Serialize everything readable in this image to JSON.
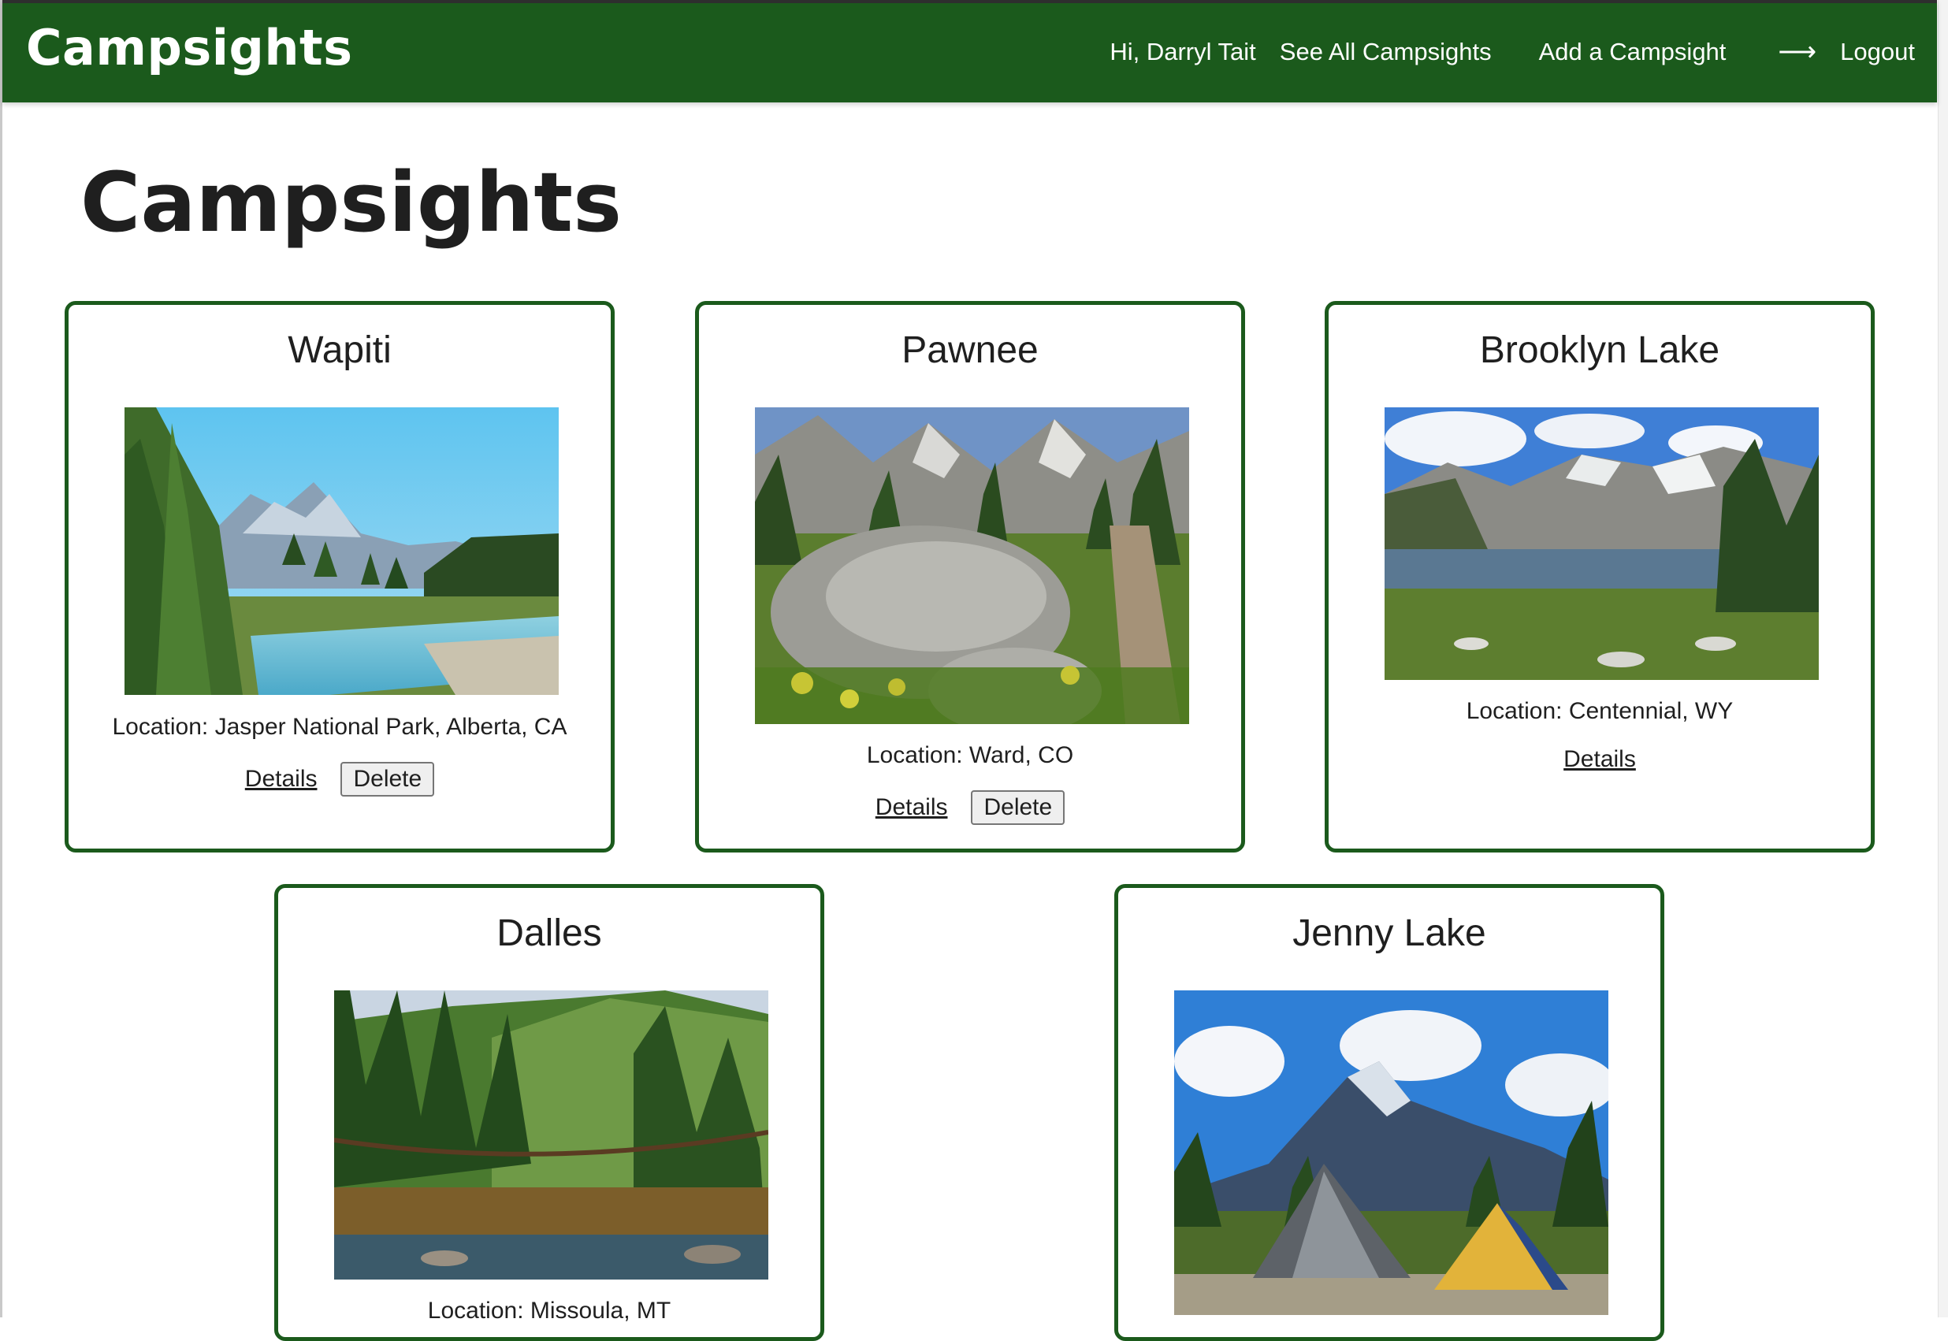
{
  "navbar": {
    "brand": "Campsights",
    "greeting": "Hi, Darryl Tait",
    "see_all": "See All Campsights",
    "add": "Add a Campsight",
    "logout_arrow": "⟶",
    "logout": "Logout"
  },
  "page": {
    "title": "Campsights"
  },
  "cards": [
    {
      "name": "Wapiti",
      "location": "Location: Jasper National Park, Alberta, CA",
      "details_label": "Details",
      "delete_label": "Delete"
    },
    {
      "name": "Pawnee",
      "location": "Location: Ward, CO",
      "details_label": "Details",
      "delete_label": "Delete"
    },
    {
      "name": "Brooklyn Lake",
      "location": "Location: Centennial, WY",
      "details_label": "Details"
    },
    {
      "name": "Dalles",
      "location": "Location: Missoula, MT"
    },
    {
      "name": "Jenny Lake"
    }
  ],
  "colors": {
    "brand_green": "#1b5a1c",
    "text": "#1f1f1f"
  }
}
